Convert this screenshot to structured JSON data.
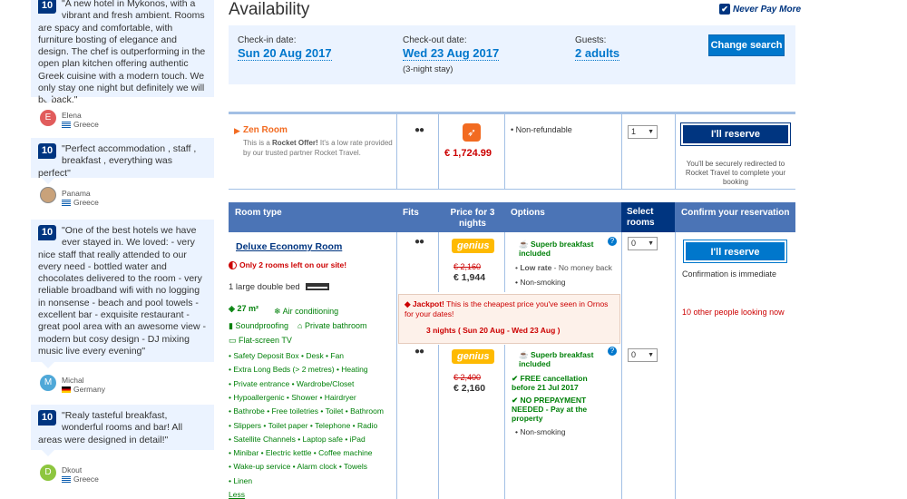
{
  "reviews": [
    {
      "score": "10",
      "text": "\"A new hotel in Mykonos, with a vibrant and fresh ambient. Rooms are spacy and comfortable, with furniture bosting of elegance and design. The chef is outperforming in the open plan kitchen offering authentic Greek cuisine with a modern touch. We only stay one night but definitely we will be back.\"",
      "initial": "E",
      "name": "Elena",
      "country": "Greece"
    },
    {
      "score": "10",
      "text": "\"Perfect accommodation , staff , breakfast , everything was perfect\"",
      "initial": "",
      "name": "Panama",
      "country": "Greece"
    },
    {
      "score": "10",
      "text": "\"One of the best hotels we have ever stayed in. We loved: - very nice staff that really attended to our every need - bottled water and chocolates delivered to the room - very reliable broadband wifi with no logging in nonsense - beach and pool towels - excellent bar - exquisite restaurant - great pool area with an awesome view - modern but cosy design - DJ mixing music live every evening\"",
      "initial": "M",
      "name": "Michal",
      "country": "Germany"
    },
    {
      "score": "10",
      "text": "\"Realy tasteful breakfast, wonderful rooms and bar! All areas were designed in detail!\"",
      "initial": "D",
      "name": "Dkout",
      "country": "Greece"
    }
  ],
  "availability": {
    "title": "Availability",
    "never_pay": "Never Pay More"
  },
  "search": {
    "checkin_label": "Check-in date:",
    "checkin": "Sun 20 Aug 2017",
    "checkout_label": "Check-out date:",
    "checkout": "Wed 23 Aug 2017",
    "stay": "(3-night stay)",
    "guests_label": "Guests:",
    "guests": "2 adults",
    "change": "Change search"
  },
  "zen": {
    "name": "Zen Room",
    "desc_pre": "This is a ",
    "desc_bold": "Rocket Offer!",
    "desc_post": " It's a low rate provided by our trusted partner Rocket Travel.",
    "price": "€ 1,724.99",
    "option": "Non-refundable",
    "qty": "1",
    "reserve": "I'll reserve",
    "redirect": "You'll be securely redirected to Rocket Travel to complete your booking"
  },
  "table": {
    "h_room": "Room type",
    "h_fits": "Fits",
    "h_price": "Price for 3 nights",
    "h_options": "Options",
    "h_select": "Select rooms",
    "h_confirm": "Confirm your reservation"
  },
  "room": {
    "name": "Deluxe Economy Room",
    "scarcity": "Only 2 rooms left on our site!",
    "bed": "1 large double bed",
    "size": "27 m²",
    "ac": "Air conditioning",
    "sound": "Soundproofing",
    "bath": "Private bathroom",
    "tv": "Flat-screen TV",
    "facilities": [
      "• Safety Deposit Box • Desk • Fan",
      "• Extra Long Beds (> 2 metres) • Heating",
      "• Private entrance • Wardrobe/Closet",
      "• Hypoallergenic • Shower • Hairdryer",
      "• Bathrobe • Free toiletries • Toilet • Bathroom",
      "• Slippers • Toilet paper • Telephone • Radio",
      "• Satellite Channels • Laptop safe • iPad",
      "• Minibar • Electric kettle • Coffee machine",
      "• Wake-up service • Alarm clock • Towels",
      "• Linen"
    ],
    "less": "Less"
  },
  "rate1": {
    "genius": "genius",
    "old": "€ 2,160",
    "new": "€ 1,944",
    "breakfast": "Superb breakfast included",
    "low": "Low rate",
    "nomoney": " - No money back",
    "smoke": "Non-smoking",
    "qty": "0",
    "reserve": "I'll reserve",
    "confirm": "Confirmation is immediate",
    "others": "10 other people looking now"
  },
  "jackpot": {
    "bold": "Jackpot!",
    "text": " This is the cheapest price you've seen in Ornos for your dates!",
    "dates": "3 nights ( Sun 20 Aug - Wed 23 Aug )"
  },
  "rate2": {
    "genius": "genius",
    "old": "€ 2,400",
    "new": "€ 2,160",
    "breakfast": "Superb breakfast included",
    "cancel": "FREE cancellation before 21 Jul 2017",
    "prepay": "NO PREPAYMENT NEEDED - Pay at the property",
    "smoke": "Non-smoking",
    "qty": "0"
  },
  "colors": {
    "brand": "#003580",
    "link": "#0077cc",
    "accent": "#feba02",
    "green": "#008009",
    "red": "#cc0000"
  }
}
